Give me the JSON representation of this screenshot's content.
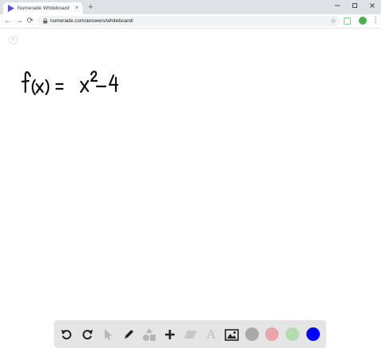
{
  "browser": {
    "tab": {
      "title": "Numerade Whiteboard",
      "close_glyph": "×",
      "favicon": "numerade-play-icon"
    },
    "new_tab_glyph": "+",
    "window_controls": [
      "minimize-icon",
      "maximize-icon",
      "close-icon"
    ],
    "nav": {
      "back": "←",
      "forward": "→",
      "reload": "⟳"
    },
    "address": {
      "url": "numerade.com/answers/whiteboard/",
      "star": "☆"
    },
    "profile_initial": "",
    "menu_glyph": "⋮"
  },
  "whiteboard": {
    "page_indicator": "1",
    "handwritten_expression": "f(x) = x^2 - 4"
  },
  "palette": {
    "tools": [
      "undo-icon",
      "redo-icon",
      "pointer-icon",
      "pencil-icon",
      "shapes-icon",
      "plus-icon",
      "eraser-icon",
      "text-icon",
      "image-icon"
    ],
    "text_tool_glyph": "A",
    "colors": [
      "#a9a9a9",
      "#e8a5ac",
      "#b5d9b0",
      "#0000ff"
    ]
  }
}
